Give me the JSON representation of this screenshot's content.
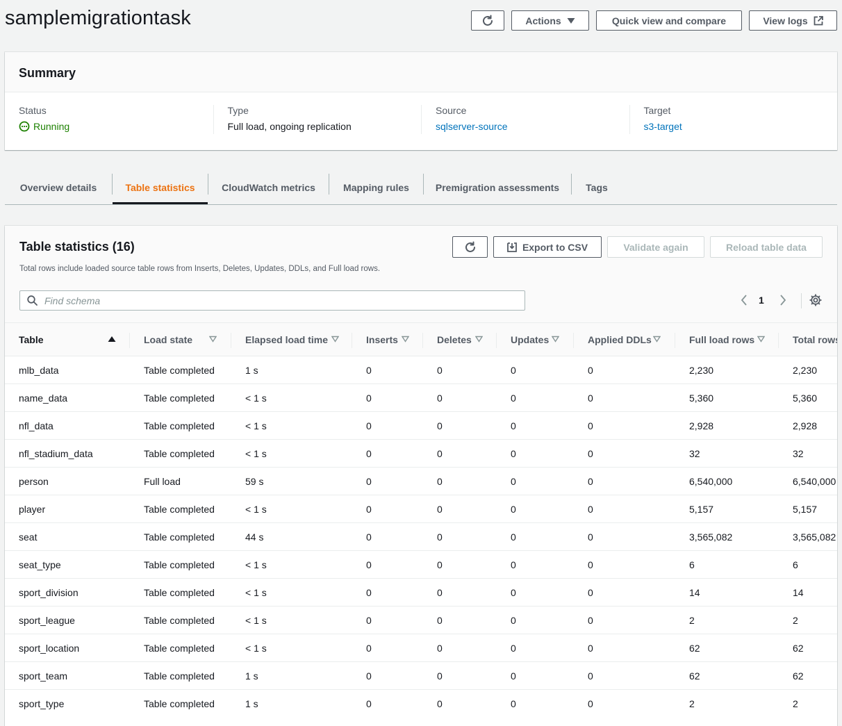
{
  "header": {
    "title": "samplemigrationtask",
    "actions_label": "Actions",
    "quick_view_label": "Quick view and compare",
    "view_logs_label": "View logs"
  },
  "summary": {
    "title": "Summary",
    "status": {
      "label": "Status",
      "value": "Running"
    },
    "type": {
      "label": "Type",
      "value": "Full load, ongoing replication"
    },
    "source": {
      "label": "Source",
      "value": "sqlserver-source"
    },
    "target": {
      "label": "Target",
      "value": "s3-target"
    }
  },
  "tabs": [
    {
      "label": "Overview details"
    },
    {
      "label": "Table statistics"
    },
    {
      "label": "CloudWatch metrics"
    },
    {
      "label": "Mapping rules"
    },
    {
      "label": "Premigration assessments"
    },
    {
      "label": "Tags"
    }
  ],
  "table_stats": {
    "title": "Table statistics (16)",
    "description": "Total rows include loaded source table rows from Inserts, Deletes, Updates, DDLs, and Full load rows.",
    "export_label": "Export to CSV",
    "validate_label": "Validate again",
    "reload_label": "Reload table data",
    "search_placeholder": "Find schema",
    "page": "1",
    "columns": [
      "Table",
      "Load state",
      "Elapsed load time",
      "Inserts",
      "Deletes",
      "Updates",
      "Applied DDLs",
      "Full load rows",
      "Total rows"
    ],
    "rows": [
      [
        "mlb_data",
        "Table completed",
        "1 s",
        "0",
        "0",
        "0",
        "0",
        "2,230",
        "2,230"
      ],
      [
        "name_data",
        "Table completed",
        "< 1 s",
        "0",
        "0",
        "0",
        "0",
        "5,360",
        "5,360"
      ],
      [
        "nfl_data",
        "Table completed",
        "< 1 s",
        "0",
        "0",
        "0",
        "0",
        "2,928",
        "2,928"
      ],
      [
        "nfl_stadium_data",
        "Table completed",
        "< 1 s",
        "0",
        "0",
        "0",
        "0",
        "32",
        "32"
      ],
      [
        "person",
        "Full load",
        "59 s",
        "0",
        "0",
        "0",
        "0",
        "6,540,000",
        "6,540,000"
      ],
      [
        "player",
        "Table completed",
        "< 1 s",
        "0",
        "0",
        "0",
        "0",
        "5,157",
        "5,157"
      ],
      [
        "seat",
        "Table completed",
        "44 s",
        "0",
        "0",
        "0",
        "0",
        "3,565,082",
        "3,565,082"
      ],
      [
        "seat_type",
        "Table completed",
        "< 1 s",
        "0",
        "0",
        "0",
        "0",
        "6",
        "6"
      ],
      [
        "sport_division",
        "Table completed",
        "< 1 s",
        "0",
        "0",
        "0",
        "0",
        "14",
        "14"
      ],
      [
        "sport_league",
        "Table completed",
        "< 1 s",
        "0",
        "0",
        "0",
        "0",
        "2",
        "2"
      ],
      [
        "sport_location",
        "Table completed",
        "< 1 s",
        "0",
        "0",
        "0",
        "0",
        "62",
        "62"
      ],
      [
        "sport_team",
        "Table completed",
        "1 s",
        "0",
        "0",
        "0",
        "0",
        "62",
        "62"
      ],
      [
        "sport_type",
        "Table completed",
        "1 s",
        "0",
        "0",
        "0",
        "0",
        "2",
        "2"
      ]
    ]
  }
}
